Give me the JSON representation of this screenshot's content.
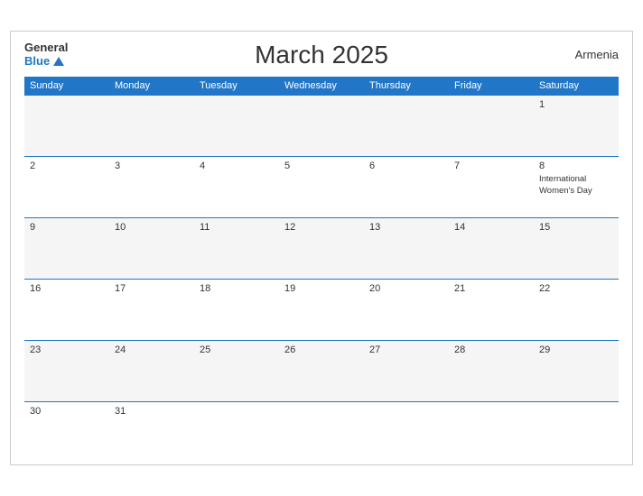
{
  "header": {
    "logo_general": "General",
    "logo_blue": "Blue",
    "title": "March 2025",
    "country": "Armenia"
  },
  "days_of_week": [
    "Sunday",
    "Monday",
    "Tuesday",
    "Wednesday",
    "Thursday",
    "Friday",
    "Saturday"
  ],
  "weeks": [
    [
      {
        "day": "",
        "events": []
      },
      {
        "day": "",
        "events": []
      },
      {
        "day": "",
        "events": []
      },
      {
        "day": "",
        "events": []
      },
      {
        "day": "",
        "events": []
      },
      {
        "day": "",
        "events": []
      },
      {
        "day": "1",
        "events": []
      }
    ],
    [
      {
        "day": "2",
        "events": []
      },
      {
        "day": "3",
        "events": []
      },
      {
        "day": "4",
        "events": []
      },
      {
        "day": "5",
        "events": []
      },
      {
        "day": "6",
        "events": []
      },
      {
        "day": "7",
        "events": []
      },
      {
        "day": "8",
        "events": [
          "International Women's Day"
        ]
      }
    ],
    [
      {
        "day": "9",
        "events": []
      },
      {
        "day": "10",
        "events": []
      },
      {
        "day": "11",
        "events": []
      },
      {
        "day": "12",
        "events": []
      },
      {
        "day": "13",
        "events": []
      },
      {
        "day": "14",
        "events": []
      },
      {
        "day": "15",
        "events": []
      }
    ],
    [
      {
        "day": "16",
        "events": []
      },
      {
        "day": "17",
        "events": []
      },
      {
        "day": "18",
        "events": []
      },
      {
        "day": "19",
        "events": []
      },
      {
        "day": "20",
        "events": []
      },
      {
        "day": "21",
        "events": []
      },
      {
        "day": "22",
        "events": []
      }
    ],
    [
      {
        "day": "23",
        "events": []
      },
      {
        "day": "24",
        "events": []
      },
      {
        "day": "25",
        "events": []
      },
      {
        "day": "26",
        "events": []
      },
      {
        "day": "27",
        "events": []
      },
      {
        "day": "28",
        "events": []
      },
      {
        "day": "29",
        "events": []
      }
    ],
    [
      {
        "day": "30",
        "events": []
      },
      {
        "day": "31",
        "events": []
      },
      {
        "day": "",
        "events": []
      },
      {
        "day": "",
        "events": []
      },
      {
        "day": "",
        "events": []
      },
      {
        "day": "",
        "events": []
      },
      {
        "day": "",
        "events": []
      }
    ]
  ]
}
